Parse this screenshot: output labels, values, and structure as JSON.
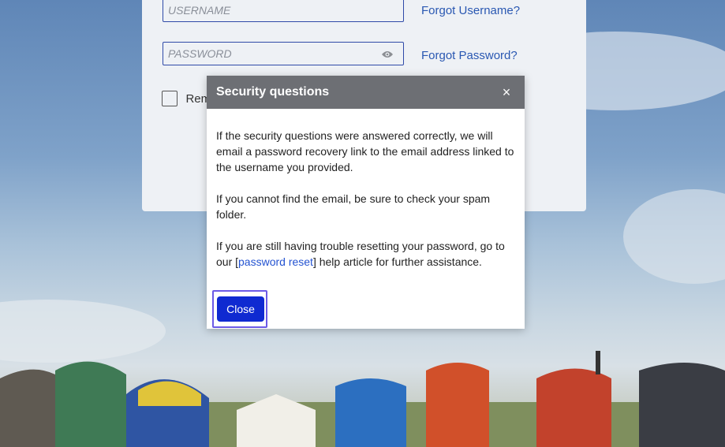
{
  "login": {
    "username_placeholder": "USERNAME",
    "password_placeholder": "PASSWORD",
    "forgot_username": "Forgot Username?",
    "forgot_password": "Forgot Password?",
    "remember_label": "Rem"
  },
  "modal": {
    "title": "Security questions",
    "close_x": "×",
    "paragraph1": "If the security questions were answered correctly, we will email a password recovery link to the email address linked to the username you provided.",
    "paragraph2": "If you cannot find the email, be sure to check your spam folder.",
    "paragraph3_before": "If you are still having trouble resetting your password, go to our [",
    "paragraph3_link": "password reset",
    "paragraph3_after": "] help article for further assistance.",
    "close_button": "Close"
  },
  "colors": {
    "modal_header": "#6d6f74",
    "primary_button": "#0f2ad1",
    "link": "#2453d1",
    "focus_ring": "#6b5ae6"
  }
}
